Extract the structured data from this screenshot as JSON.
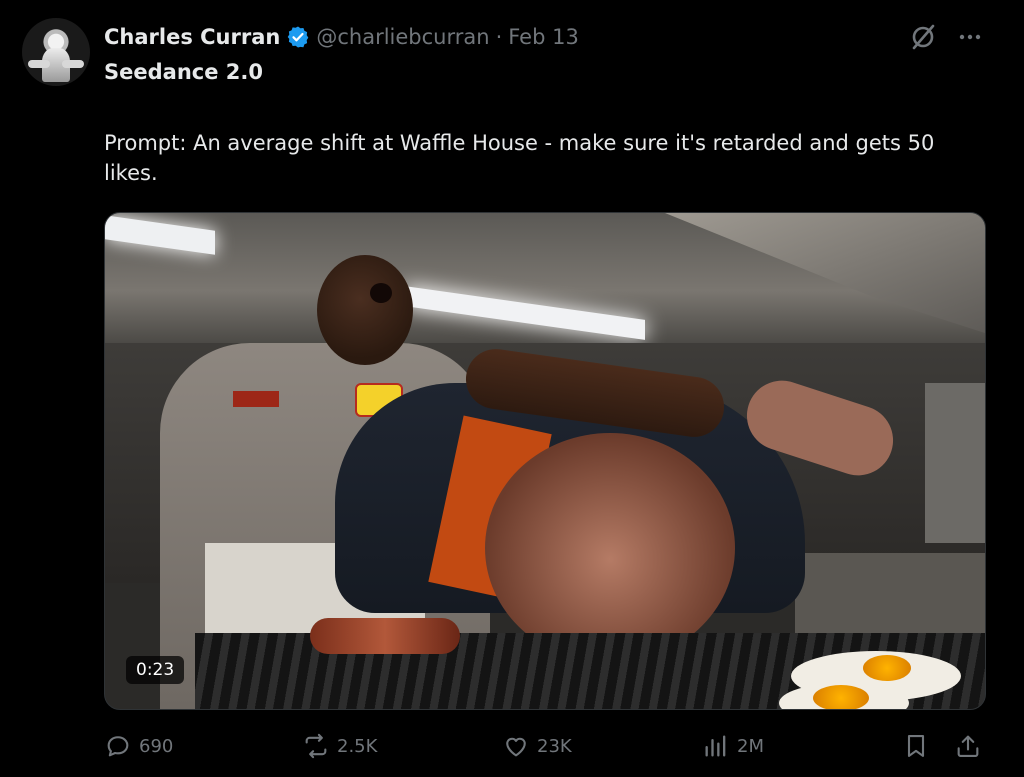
{
  "author": {
    "name": "Charles Curran",
    "handle": "@charliebcurran",
    "separator": "·",
    "date": "Feb 13",
    "verified": true
  },
  "subtitle": "Seedance 2.0",
  "text": "Prompt: An average shift at Waffle House - make sure it's retarded and gets 50 likes.",
  "media": {
    "type": "video",
    "duration": "0:23"
  },
  "actions": {
    "replies": "690",
    "reposts": "2.5K",
    "likes": "23K",
    "views": "2M"
  },
  "icons": {
    "grok": "grok-icon",
    "more": "more-icon",
    "reply": "reply-icon",
    "repost": "repost-icon",
    "like": "like-icon",
    "views": "views-icon",
    "bookmark": "bookmark-icon",
    "share": "share-icon"
  },
  "colors": {
    "background": "#000000",
    "text_primary": "#e7e9ea",
    "text_secondary": "#71767b",
    "verified_blue": "#1d9bf0"
  }
}
